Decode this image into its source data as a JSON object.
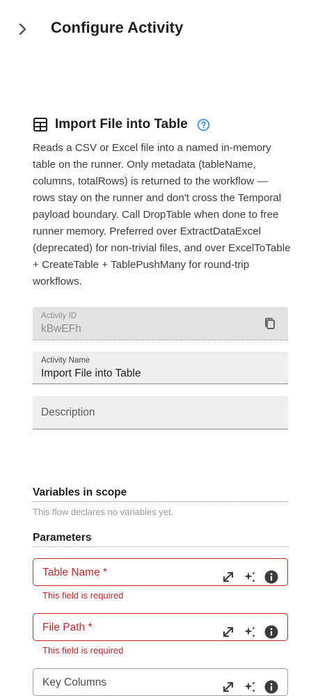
{
  "header": {
    "title": "Configure Activity"
  },
  "activity": {
    "title": "Import File into Table",
    "description": "Reads a CSV or Excel file into a named in-memory table on the runner. Only metadata (tableName, columns, totalRows) is returned to the workflow — rows stay on the runner and don't cross the Temporal payload boundary. Call DropTable when done to free runner memory. Preferred over ExtractDataExcel (deprecated) for non-trivial files, and over ExcelToTable + CreateTable + TablePushMany for round-trip workflows."
  },
  "fields": {
    "activity_id": {
      "label": "Activity ID",
      "value": "kBwEFh"
    },
    "activity_name": {
      "label": "Activity Name",
      "value": "Import File into Table"
    },
    "description": {
      "placeholder": "Description"
    }
  },
  "variables": {
    "title": "Variables in scope",
    "empty_note": "This flow declares no variables yet."
  },
  "parameters": {
    "title": "Parameters",
    "items": [
      {
        "label": "Table Name *",
        "error": "This field is required"
      },
      {
        "label": "File Path *",
        "error": "This field is required"
      },
      {
        "label": "Key Columns",
        "error": ""
      }
    ]
  },
  "colors": {
    "error": "#c62828",
    "help_accent": "#1e88e5",
    "field_bg": "#efefef"
  },
  "icons": [
    "chevron-right-icon",
    "table-icon",
    "help-circle-icon",
    "copy-icon",
    "expand-icon",
    "sparkle-icon",
    "info-icon"
  ]
}
